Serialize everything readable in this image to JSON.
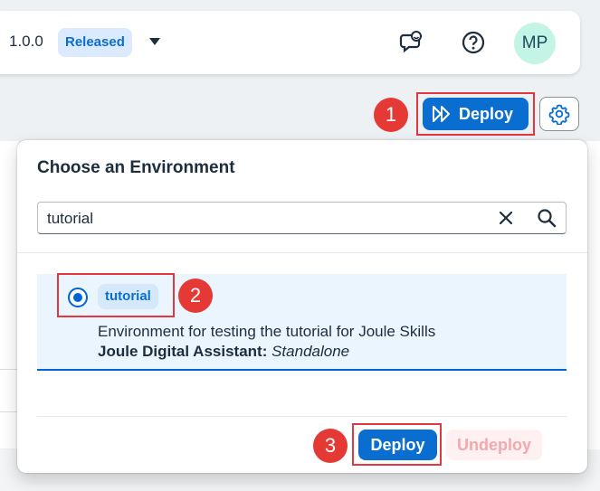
{
  "header": {
    "version": "1.0.0",
    "status_badge": "Released",
    "icons": [
      "joule-chat-icon",
      "help-icon"
    ],
    "avatar_initials": "MP"
  },
  "toolbar": {
    "deploy_label": "Deploy",
    "settings_icon": "gear-icon"
  },
  "dialog": {
    "title": "Choose an Environment",
    "search": {
      "value": "tutorial"
    },
    "environments": [
      {
        "name": "tutorial",
        "selected": true,
        "description": "Environment for testing the tutorial for Joule Skills",
        "assistant_label": "Joule Digital Assistant:",
        "assistant_value": "Standalone"
      }
    ],
    "deploy_label": "Deploy",
    "undeploy_label": "Undeploy"
  },
  "steps": [
    "1",
    "2",
    "3"
  ],
  "colors": {
    "accent": "#0a6ed1",
    "step_marker": "#e53935",
    "selected_row": "#eaf5fe"
  }
}
